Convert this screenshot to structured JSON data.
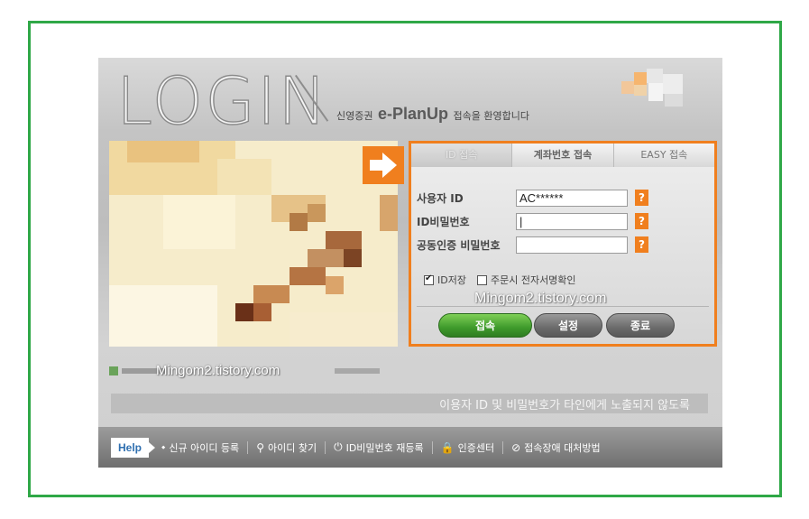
{
  "header": {
    "logo": "LOGIN",
    "welcome_prefix": "신영증권",
    "brand": "e-PlanUp",
    "welcome_suffix": "접속을 환영합니다"
  },
  "tabs": [
    {
      "label": "ID 접속"
    },
    {
      "label": "계좌번호 접속"
    },
    {
      "label": "EASY 접속"
    }
  ],
  "form": {
    "user_id_label": "사용자 ID",
    "user_id_value": "AC******",
    "password_label": "ID비밀번호",
    "password_value": "|",
    "cert_password_label": "공동인증 비밀번호",
    "cert_password_value": "",
    "help_glyph": "?"
  },
  "checks": {
    "save_id_label": "ID저장",
    "save_id_checked": true,
    "sign_confirm_label": "주문시 전자서명확인",
    "sign_confirm_checked": false
  },
  "buttons": {
    "connect": "접속",
    "settings": "설정",
    "exit": "종료"
  },
  "watermark": "Mingom2.tistory.com",
  "notice": "이용자 ID 및 비밀번호가 타인에게 노출되지 않도록",
  "footer": {
    "help": "Help",
    "items": [
      {
        "icon": "info-icon",
        "glyph": "⬩",
        "label": "신규 아이디 등록"
      },
      {
        "icon": "search-icon",
        "glyph": "⚲",
        "label": "아이디 찾기"
      },
      {
        "icon": "power-icon",
        "glyph": "⏻",
        "label": "ID비밀번호 재등록"
      },
      {
        "icon": "lock-icon",
        "glyph": "🔒",
        "label": "인증센터"
      },
      {
        "icon": "check-icon",
        "glyph": "⊘",
        "label": "접속장애 대처방법"
      }
    ]
  },
  "colors": {
    "accent": "#f07f1e",
    "frame": "#2fa847",
    "connect_button": "#3f9a2c"
  }
}
